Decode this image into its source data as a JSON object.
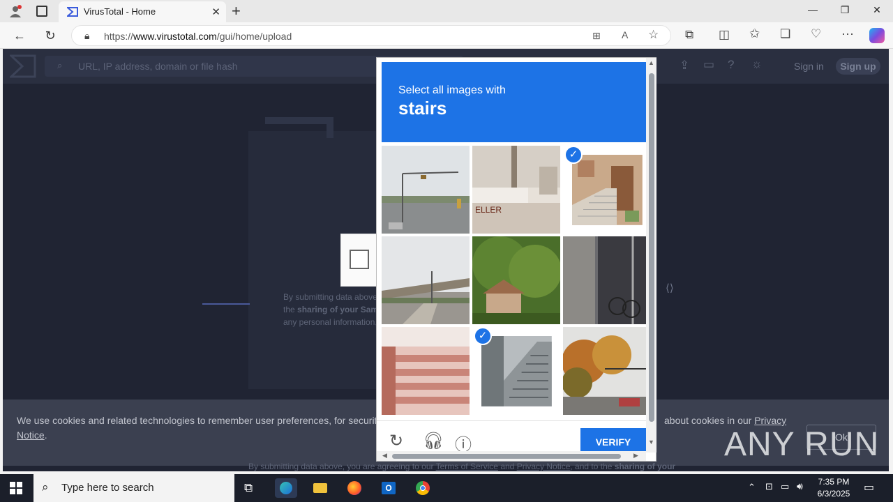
{
  "browser": {
    "tab_title": "VirusTotal - Home",
    "url_prefix": "https://",
    "url_host": "www.virustotal.com",
    "url_path": "/gui/home/upload"
  },
  "vt": {
    "search_placeholder": "URL, IP address, domain or file hash",
    "sign_in": "Sign in",
    "sign_up": "Sign up",
    "terms_line1": "By submitting data above,",
    "terms_line2a": "the ",
    "terms_line2b": "sharing of your Samp",
    "terms_line3": "any personal information,",
    "bottom_text_a": "By submitting data above, you are agreeing to our ",
    "bottom_terms": "Terms of Service",
    "bottom_and": " and ",
    "bottom_privacy": "Privacy Notice",
    "bottom_text_b": ", and to the ",
    "bottom_sharing": "sharing of your"
  },
  "cookie": {
    "text_left": "We use cookies and related technologies to remember user preferences, for security, to",
    "text_right": "about cookies in our ",
    "privacy_link": "Privacy",
    "notice_link": "Notice",
    "notice_end": ".",
    "ok_label": "Ok"
  },
  "captcha": {
    "prompt": "Select all images with",
    "target": "stairs",
    "verify_label": "VERIFY",
    "tiles": [
      {
        "name": "intersection",
        "selected": false
      },
      {
        "name": "building-pole",
        "selected": false
      },
      {
        "name": "stone-stairs",
        "selected": true
      },
      {
        "name": "overpass",
        "selected": false
      },
      {
        "name": "tree-house",
        "selected": false
      },
      {
        "name": "bicycle-wall",
        "selected": false
      },
      {
        "name": "red-stairs",
        "selected": false
      },
      {
        "name": "outdoor-staircase",
        "selected": true
      },
      {
        "name": "autumn-street",
        "selected": false
      }
    ]
  },
  "watermark": "ANY RUN",
  "taskbar": {
    "search_placeholder": "Type here to search",
    "time": "7:35 PM",
    "date": "6/3/2025"
  }
}
